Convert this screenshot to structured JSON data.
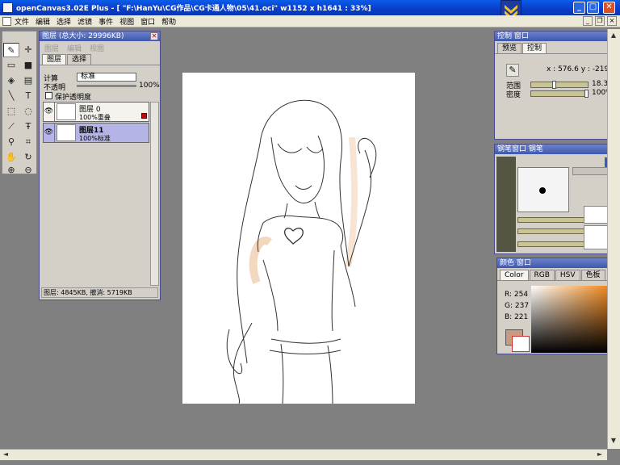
{
  "window": {
    "title": "openCanvas3.02E Plus - [ \"F:\\HanYu\\CG作品\\CG卡通人物\\05\\41.oci\" w1152 x h1641 : 33%]"
  },
  "menu": [
    "文件",
    "编辑",
    "选择",
    "滤镜",
    "事件",
    "视图",
    "窗口",
    "帮助"
  ],
  "layers_panel": {
    "title": "图层 (总大小: 29996KB)",
    "submenu": [
      "图层",
      "编辑",
      "视图"
    ],
    "tabs": [
      "图层",
      "选择"
    ],
    "calc_label": "计算",
    "blend_mode": "标准",
    "opacity_label": "不透明",
    "opacity_value": "100%",
    "protect_label": "保护透明度",
    "layers": [
      {
        "name": "图层 0",
        "mode": "100%重叠"
      },
      {
        "name": "图层11",
        "mode": "100%标准"
      }
    ],
    "status": "图层: 4845KB, 撤消: 5719KB"
  },
  "control_panel": {
    "title": "控制 窗口",
    "tabs": [
      "预览",
      "控制"
    ],
    "coords": "x : 576.6  y : -219.2",
    "range_label": "范围",
    "range_value": "18.3",
    "density_label": "密度",
    "density_value": "100%",
    "range_fraction": 0.4,
    "density_fraction": 1.0
  },
  "pen_panel": {
    "title": "钢笔窗口  钢笔"
  },
  "color_panel": {
    "title": "颜色 窗口",
    "tabs": [
      "Color",
      "RGB",
      "HSV",
      "色板"
    ],
    "r": "R: 254",
    "g": "G: 237",
    "b": "B: 221",
    "fg_color": "#c89a80",
    "bg_color": "#ffffff"
  },
  "colors": {
    "titlebar": "#0a4fd6",
    "workspace": "#808080",
    "panel": "#d4d0c8",
    "layer_selected": "#b5b4e6"
  }
}
